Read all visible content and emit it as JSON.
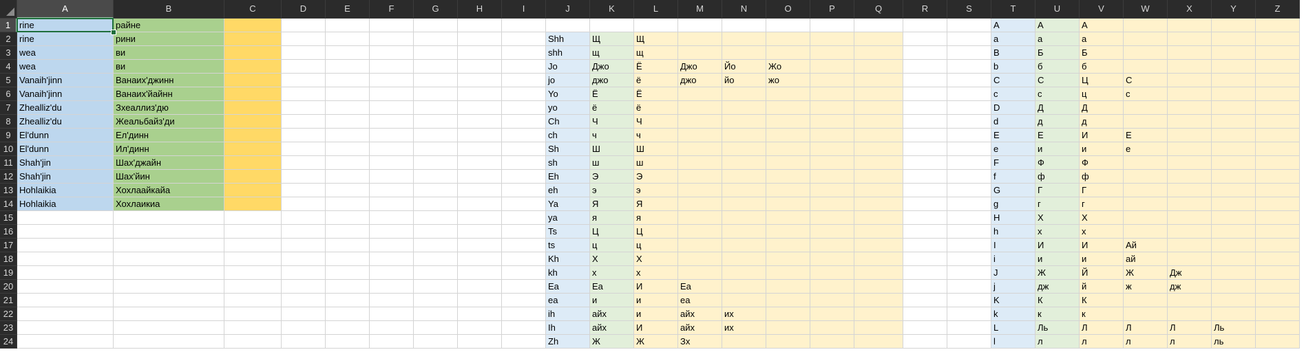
{
  "sheet": {
    "columns": [
      "A",
      "B",
      "C",
      "D",
      "E",
      "F",
      "G",
      "H",
      "I",
      "J",
      "K",
      "L",
      "M",
      "N",
      "O",
      "P",
      "Q",
      "R",
      "S",
      "T",
      "U",
      "V",
      "W",
      "X",
      "Y",
      "Z"
    ],
    "selected_column": "A",
    "selected_row": 1,
    "active_cell": "A1",
    "fill_colors": {
      "blue": "#bdd7ee",
      "green": "#a9d08e",
      "gold": "#ffd966",
      "light_blue": "#ddebf7",
      "light_green": "#e2efda",
      "light_yellow": "#fff2cc"
    },
    "rows": [
      {
        "A": "rine",
        "B": "райне",
        "T": "A",
        "U": "А",
        "V": "А"
      },
      {
        "A": "rine",
        "B": "рини",
        "J": "Shh",
        "K": "Щ",
        "L": "Щ",
        "T": "a",
        "U": "а",
        "V": "а"
      },
      {
        "A": "wea",
        "B": "ви",
        "J": "shh",
        "K": "щ",
        "L": "щ",
        "T": "B",
        "U": "Б",
        "V": "Б"
      },
      {
        "A": "wea",
        "B": "ви",
        "J": "Jo",
        "K": "Джо",
        "L": "Ё",
        "M": "Джо",
        "N": "Йо",
        "O": "Жо",
        "T": "b",
        "U": "б",
        "V": "б"
      },
      {
        "A": "Vanaih'jinn",
        "B": "Ванаих'джинн",
        "J": "jo",
        "K": "джо",
        "L": "ё",
        "M": "джо",
        "N": "йо",
        "O": "жо",
        "T": "C",
        "U": "С",
        "V": "Ц",
        "W": "С"
      },
      {
        "A": "Vanaih'jinn",
        "B": "Ванаих'йайнн",
        "J": "Yo",
        "K": "Ё",
        "L": "Ё",
        "T": "c",
        "U": "с",
        "V": "ц",
        "W": "с"
      },
      {
        "A": "Zhealliz'du",
        "B": "Зхеаллиз'дю",
        "J": "yo",
        "K": "ё",
        "L": "ё",
        "T": "D",
        "U": "Д",
        "V": "Д"
      },
      {
        "A": "Zhealliz'du",
        "B": "Жеальбайз'ди",
        "J": "Ch",
        "K": "Ч",
        "L": "Ч",
        "T": "d",
        "U": "д",
        "V": "д"
      },
      {
        "A": "El'dunn",
        "B": "Ел'динн",
        "J": "ch",
        "K": "ч",
        "L": "ч",
        "T": "E",
        "U": "Е",
        "V": "И",
        "W": "Е"
      },
      {
        "A": "El'dunn",
        "B": "Ил'динн",
        "J": "Sh",
        "K": "Ш",
        "L": "Ш",
        "T": "e",
        "U": "и",
        "V": "и",
        "W": "е"
      },
      {
        "A": "Shah'jin",
        "B": "Шах'джайн",
        "J": "sh",
        "K": "ш",
        "L": "ш",
        "T": "F",
        "U": "Ф",
        "V": "Ф"
      },
      {
        "A": "Shah'jin",
        "B": "Шах'йин",
        "J": "Eh",
        "K": "Э",
        "L": "Э",
        "T": "f",
        "U": "ф",
        "V": "ф"
      },
      {
        "A": "Hohlaikia",
        "B": "Хохлаайкайа",
        "J": "eh",
        "K": "э",
        "L": "э",
        "T": "G",
        "U": "Г",
        "V": "Г"
      },
      {
        "A": "Hohlaikia",
        "B": "Хохлаикиа",
        "J": "Ya",
        "K": "Я",
        "L": "Я",
        "T": "g",
        "U": "г",
        "V": "г"
      },
      {
        "J": "ya",
        "K": "я",
        "L": "я",
        "T": "H",
        "U": "Х",
        "V": "Х"
      },
      {
        "J": "Ts",
        "K": "Ц",
        "L": "Ц",
        "T": "h",
        "U": "х",
        "V": "х"
      },
      {
        "J": "ts",
        "K": "ц",
        "L": "ц",
        "T": "I",
        "U": "И",
        "V": "И",
        "W": "Ай"
      },
      {
        "J": "Kh",
        "K": "Х",
        "L": "Х",
        "T": "i",
        "U": "и",
        "V": "и",
        "W": "ай"
      },
      {
        "J": "kh",
        "K": "х",
        "L": "х",
        "T": "J",
        "U": "Ж",
        "V": "Й",
        "W": "Ж",
        "X": "Дж"
      },
      {
        "J": "Ea",
        "K": "Еа",
        "L": "И",
        "M": "Еа",
        "T": "j",
        "U": "дж",
        "V": "й",
        "W": "ж",
        "X": "дж"
      },
      {
        "J": "ea",
        "K": "и",
        "L": "и",
        "M": "еа",
        "T": "K",
        "U": "К",
        "V": "К"
      },
      {
        "J": "ih",
        "K": "айх",
        "L": "и",
        "M": "айх",
        "N": "их",
        "T": "k",
        "U": "к",
        "V": "к"
      },
      {
        "J": "Ih",
        "K": "айх",
        "L": "И",
        "M": "айх",
        "N": "их",
        "T": "L",
        "U": "Ль",
        "V": "Л",
        "W": "Л",
        "X": "Л",
        "Y": "Ль"
      },
      {
        "J": "Zh",
        "K": "Ж",
        "L": "Ж",
        "M": "Зх",
        "T": "l",
        "U": "л",
        "V": "л",
        "W": "л",
        "X": "л",
        "Y": "ль"
      }
    ]
  }
}
